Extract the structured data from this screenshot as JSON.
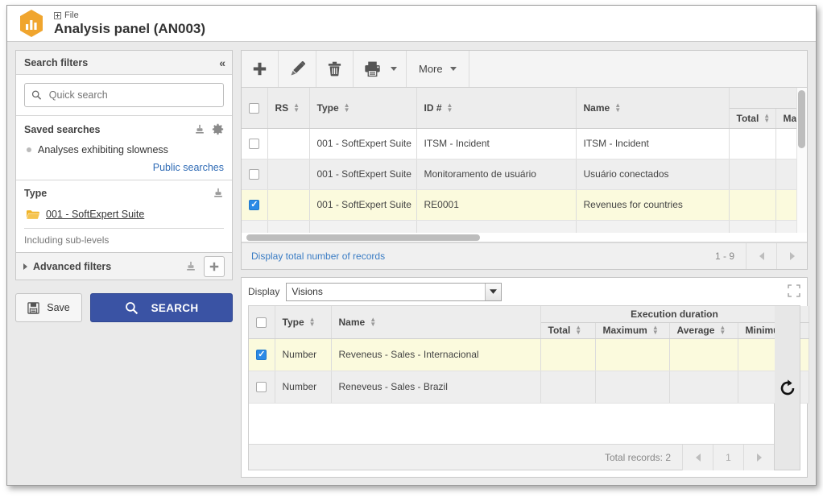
{
  "window": {
    "file_label": "File",
    "title": "Analysis panel (AN003)",
    "app_icon": "bar-chart-hex-icon"
  },
  "sidebar": {
    "header": {
      "title": "Search filters",
      "collapse_icon": "chevron-double-left-icon"
    },
    "quick_search": {
      "placeholder": "Quick search",
      "value": "",
      "icon": "search-icon"
    },
    "saved_searches": {
      "title": "Saved searches",
      "icons": [
        "eraser-icon",
        "gear-icon"
      ],
      "items": [
        {
          "label": "Analyses exhibiting slowness"
        }
      ],
      "public_link": "Public searches"
    },
    "type_filter": {
      "title": "Type",
      "icon": "eraser-icon",
      "value": "001 - SoftExpert Suite",
      "folder_icon": "folder-icon",
      "sub_levels_label": "Including sub-levels"
    },
    "advanced_filters": {
      "label": "Advanced filters",
      "expand_icon": "triangle-right-icon",
      "clear_icon": "eraser-icon",
      "add_icon": "plus-icon"
    },
    "buttons": {
      "save_label": "Save",
      "save_icon": "floppy-disk-icon",
      "search_label": "SEARCH",
      "search_icon": "search-icon"
    }
  },
  "toolbar": {
    "items": [
      {
        "name": "add",
        "icon": "plus-icon",
        "label": ""
      },
      {
        "name": "edit",
        "icon": "pencil-icon",
        "label": ""
      },
      {
        "name": "delete",
        "icon": "trash-icon",
        "label": ""
      },
      {
        "name": "print",
        "icon": "printer-icon",
        "label": ""
      },
      {
        "name": "more",
        "icon": "chevron-down-icon",
        "label": "More"
      }
    ],
    "more_label": "More"
  },
  "main_grid": {
    "columns": [
      {
        "key": "rs",
        "label": "RS",
        "sortable": true
      },
      {
        "key": "type",
        "label": "Type",
        "sortable": true
      },
      {
        "key": "id",
        "label": "ID #",
        "sortable": true
      },
      {
        "key": "name",
        "label": "Name",
        "sortable": true
      }
    ],
    "group_header": "",
    "metric_columns": [
      {
        "key": "total",
        "label": "Total",
        "sortable": true
      },
      {
        "key": "max",
        "label": "Max",
        "sortable": true
      }
    ],
    "rows": [
      {
        "selected": false,
        "rs": "",
        "type": "001 - SoftExpert Suite",
        "id": "ITSM - Incident",
        "name": "ITSM - Incident",
        "total": "",
        "max": ""
      },
      {
        "selected": false,
        "rs": "",
        "type": "001 - SoftExpert Suite",
        "id": "Monitoramento de usuário",
        "name": "Usuário conectados",
        "total": "",
        "max": ""
      },
      {
        "selected": true,
        "rs": "",
        "type": "001 - SoftExpert Suite",
        "id": "RE0001",
        "name": "Revenues for countries",
        "total": "",
        "max": ""
      }
    ],
    "footer": {
      "total_records_link": "Display total number of records",
      "range": "1 - 9",
      "prev_icon": "arrow-left-icon",
      "next_icon": "arrow-right-icon"
    }
  },
  "lower_panel": {
    "display_label": "Display",
    "display_value": "Visions",
    "expand_icon": "expand-icon",
    "refresh_icon": "refresh-icon",
    "columns": [
      {
        "key": "type",
        "label": "Type",
        "sortable": true
      },
      {
        "key": "name",
        "label": "Name",
        "sortable": true
      }
    ],
    "group_header": "Execution duration",
    "metric_columns": [
      {
        "key": "total",
        "label": "Total",
        "sortable": true
      },
      {
        "key": "maximum",
        "label": "Maximum",
        "sortable": true
      },
      {
        "key": "average",
        "label": "Average",
        "sortable": true
      },
      {
        "key": "minimum",
        "label": "Minimum",
        "sortable": true
      }
    ],
    "rows": [
      {
        "selected": true,
        "type": "Number",
        "name": "Reveneus - Sales - Internacional",
        "total": "",
        "maximum": "",
        "average": "",
        "minimum": ""
      },
      {
        "selected": false,
        "type": "Number",
        "name": "Reneveus - Sales - Brazil",
        "total": "",
        "maximum": "",
        "average": "",
        "minimum": ""
      }
    ],
    "footer": {
      "total_records": "Total records: 2",
      "page": "1",
      "prev_icon": "arrow-left-icon",
      "next_icon": "arrow-right-icon"
    }
  },
  "colors": {
    "accent_blue": "#3a53a4",
    "link_blue": "#3a7cc4",
    "selected_row": "#fbfadd",
    "alt_row": "#eeeeee",
    "header_gray": "#ededed",
    "brand_orange": "#f0a52e"
  }
}
